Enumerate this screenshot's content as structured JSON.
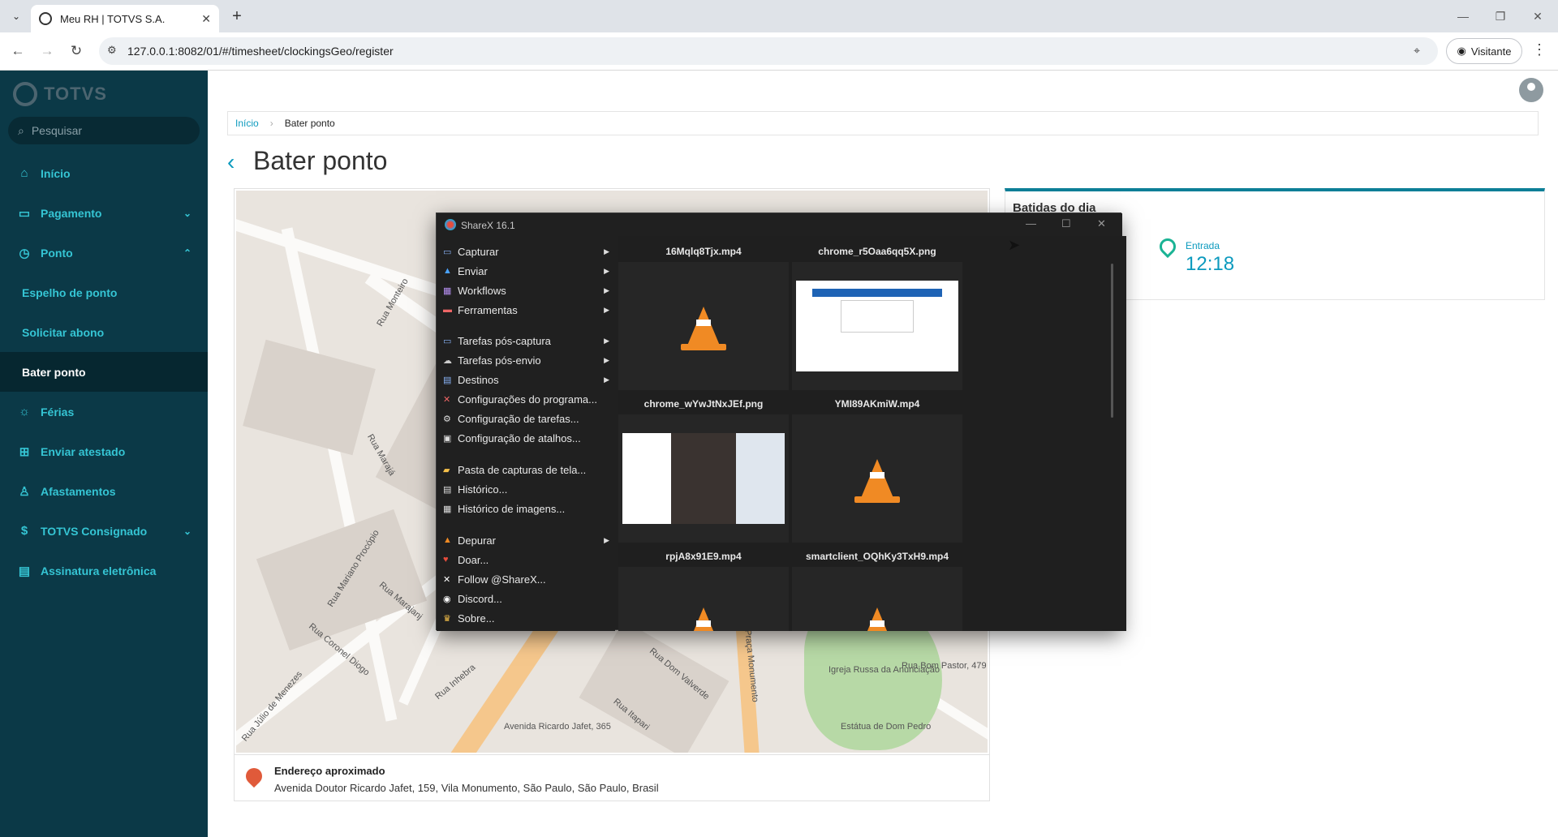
{
  "browser": {
    "tab_title": "Meu RH | TOTVS S.A.",
    "url": "127.0.0.1:8082/01/#/timesheet/clockingsGeo/register",
    "profile_label": "Visitante"
  },
  "sidebar": {
    "logo": "TOTVS",
    "search_placeholder": "Pesquisar",
    "items": [
      {
        "label": "Início",
        "icon": "home-icon"
      },
      {
        "label": "Pagamento",
        "icon": "money-icon",
        "chevron": "down"
      },
      {
        "label": "Ponto",
        "icon": "clock-icon",
        "chevron": "up"
      },
      {
        "label": "Espelho de ponto",
        "sub": true
      },
      {
        "label": "Solicitar abono",
        "sub": true
      },
      {
        "label": "Bater ponto",
        "sub": true,
        "active": true
      },
      {
        "label": "Férias",
        "icon": "sun-icon"
      },
      {
        "label": "Enviar atestado",
        "icon": "medical-icon"
      },
      {
        "label": "Afastamentos",
        "icon": "person-icon"
      },
      {
        "label": "TOTVS Consignado",
        "icon": "money-icon",
        "chevron": "down"
      },
      {
        "label": "Assinatura eletrônica",
        "icon": "document-icon"
      }
    ]
  },
  "main": {
    "breadcrumb": {
      "home": "Início",
      "current": "Bater ponto"
    },
    "page_title": "Bater ponto",
    "map_labels": [
      "Rua Monteiro",
      "Rua Marajá",
      "Rua Coronel Diogo",
      "Rua Mariano Procópio",
      "Rua Marajanj",
      "Rua Dom Valverde",
      "Rua Itapari",
      "Praça Monumento",
      "Igreja Russa da Anunciação",
      "Estátua de Dom Pedro",
      "Avenida Ricardo Jafet, 365",
      "Rua Bom Pastor, 479",
      "Rua Inhebra",
      "Rua Júlio de Menezes"
    ],
    "address_title": "Endereço aproximado",
    "address_value": "Avenida Doutor Ricardo Jafet, 159, Vila Monumento, São Paulo, São Paulo, Brasil",
    "batidas": {
      "title": "Batidas do dia",
      "entry_label": "Entrada",
      "entry_time": "12:18"
    }
  },
  "sharex": {
    "title": "ShareX 16.1",
    "menu": [
      {
        "label": "Capturar",
        "submenu": true
      },
      {
        "label": "Enviar",
        "submenu": true
      },
      {
        "label": "Workflows",
        "submenu": true
      },
      {
        "label": "Ferramentas",
        "submenu": true
      },
      {
        "label": "Tarefas pós-captura",
        "submenu": true
      },
      {
        "label": "Tarefas pós-envio",
        "submenu": true
      },
      {
        "label": "Destinos",
        "submenu": true
      },
      {
        "label": "Configurações do programa...",
        "submenu": false
      },
      {
        "label": "Configuração de tarefas...",
        "submenu": false
      },
      {
        "label": "Configuração de atalhos...",
        "submenu": false
      },
      {
        "label": "Pasta de capturas de tela...",
        "submenu": false
      },
      {
        "label": "Histórico...",
        "submenu": false
      },
      {
        "label": "Histórico de imagens...",
        "submenu": false
      },
      {
        "label": "Depurar",
        "submenu": true
      },
      {
        "label": "Doar...",
        "submenu": false
      },
      {
        "label": "Follow @ShareX...",
        "submenu": false
      },
      {
        "label": "Discord...",
        "submenu": false
      },
      {
        "label": "Sobre...",
        "submenu": false
      }
    ],
    "files": [
      {
        "name": "16Mqlq8Tjx.mp4",
        "kind": "video"
      },
      {
        "name": "chrome_r5Oaa6qq5X.png",
        "kind": "image"
      },
      {
        "name": "chrome_wYwJtNxJEf.png",
        "kind": "image"
      },
      {
        "name": "YMI89AKmiW.mp4",
        "kind": "video"
      },
      {
        "name": "rpjA8x91E9.mp4",
        "kind": "video"
      },
      {
        "name": "smartclient_OQhKy3TxH9.mp4",
        "kind": "video"
      }
    ]
  },
  "colors": {
    "sidebar_bg": "#0b3947",
    "accent": "#0c9abe",
    "sidebar_text": "#35c5d4"
  }
}
